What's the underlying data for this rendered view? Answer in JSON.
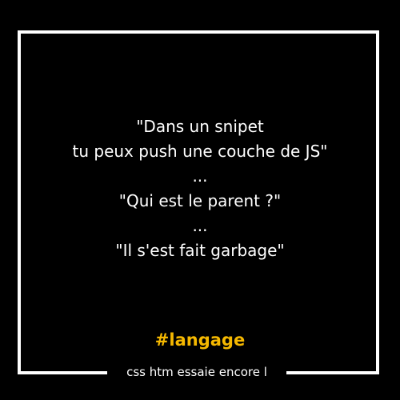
{
  "quote": {
    "lines": [
      "\"Dans un snipet",
      "tu peux push une couche de JS\"",
      "...",
      "\"Qui est le parent ?\"",
      "...",
      "\"Il s'est fait garbage\""
    ]
  },
  "hashtag": "#langage",
  "footer": "css htm essaie encore l",
  "colors": {
    "background": "#000000",
    "frame": "#ffffff",
    "text": "#ffffff",
    "accent": "#f5b800"
  }
}
